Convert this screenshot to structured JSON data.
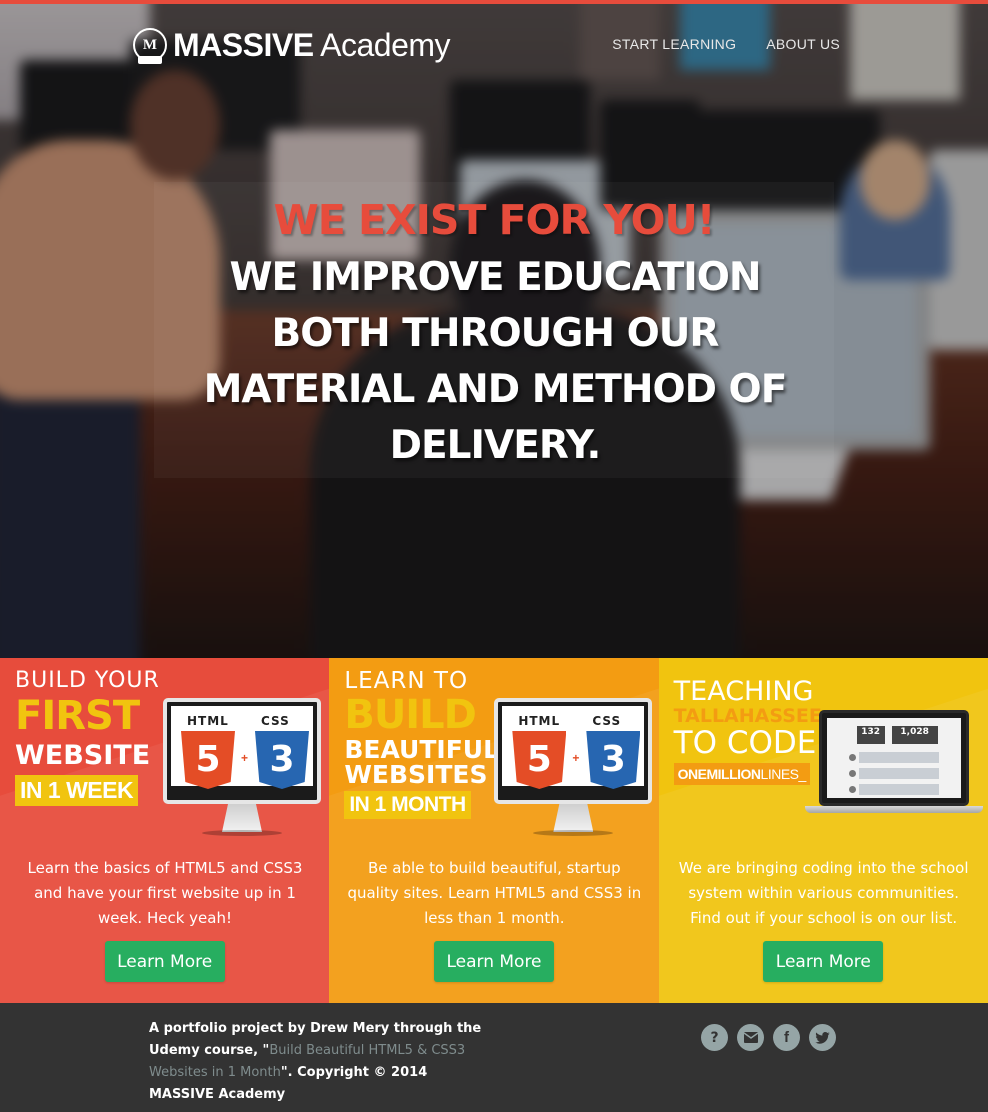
{
  "colors": {
    "top_stripe": "#e74c3c",
    "kicker": "#e74c3c",
    "panel_red": "#e74c3c",
    "panel_orange": "#f39c12",
    "panel_yellow": "#f1c40f",
    "button_green": "#27ae60",
    "footer_bg": "#333333",
    "footer_link": "#7f8c8d",
    "social_icon_bg": "#95a5a6"
  },
  "header": {
    "logo_crest_letter": "M",
    "logo_bold": "MASSIVE",
    "logo_light": " Academy",
    "nav": [
      "START LEARNING",
      "ABOUT US"
    ]
  },
  "hero": {
    "kicker": "WE EXIST FOR YOU!",
    "headline": "WE IMPROVE EDUCATION BOTH THROUGH OUR MATERIAL AND METHOD OF DELIVERY."
  },
  "panels": [
    {
      "banner": {
        "line1": "BUILD YOUR",
        "line2": "FIRST",
        "line3": "WEBSITE",
        "tag": "IN 1 WEEK"
      },
      "badges": {
        "left_label": "HTML",
        "left_num": "5",
        "right_label": "CSS",
        "right_num": "3",
        "plus": "+"
      },
      "text": "Learn the basics of HTML5 and CSS3 and have your first website up in 1 week. Heck yeah!",
      "button": "Learn More"
    },
    {
      "banner": {
        "line1": "LEARN TO",
        "line2": "BUILD",
        "line3": "BEAUTIFUL",
        "line4": "WEBSITES",
        "tag": "IN 1 MONTH"
      },
      "badges": {
        "left_label": "HTML",
        "left_num": "5",
        "right_label": "CSS",
        "right_num": "3",
        "plus": "+"
      },
      "text": "Be able to build beautiful, startup quality sites. Learn HTML5 and CSS3 in less than 1 month.",
      "button": "Learn More"
    },
    {
      "banner": {
        "line1": "TEACHING",
        "line2": "TALLAHASSEE",
        "line3": "TO CODE",
        "tag_bold": "ONEMILLION",
        "tag_light": "LINES_"
      },
      "laptop": {
        "stat1": "132",
        "stat2": "1,028"
      },
      "text": "We are bringing coding into the school system within various communities. Find out if your school is on our list.",
      "button": "Learn More"
    }
  ],
  "footer": {
    "text_before": "A portfolio project by Drew Mery through the Udemy course, \"",
    "link": "Build Beautiful HTML5 & CSS3 Websites in 1 Month",
    "text_after": "\". Copyright © 2014 MASSIVE Academy",
    "social_icons": [
      "question-icon",
      "envelope-icon",
      "facebook-icon",
      "twitter-icon"
    ]
  }
}
